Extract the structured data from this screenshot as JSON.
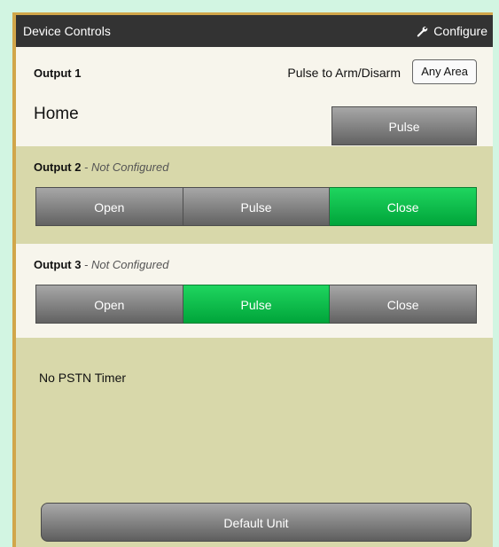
{
  "header": {
    "title": "Device Controls",
    "configure_label": "Configure"
  },
  "output1": {
    "name": "Output 1",
    "status": "Home",
    "pulse_label": "Pulse to Arm/Disarm",
    "area_button": "Any Area",
    "pulse_button": "Pulse"
  },
  "output2": {
    "name": "Output 2",
    "note": " - Not Configured",
    "buttons": [
      "Open",
      "Pulse",
      "Close"
    ],
    "active": "Close"
  },
  "output3": {
    "name": "Output 3",
    "note": " - Not Configured",
    "buttons": [
      "Open",
      "Pulse",
      "Close"
    ],
    "active": "Pulse"
  },
  "pstn": {
    "label": "No PSTN Timer"
  },
  "footer": {
    "default_button": "Default Unit"
  },
  "colors": {
    "titlebar": "#333333",
    "accent_green": "#00b140",
    "panel_olive": "#d8d8aa",
    "panel_light": "#f7f5ec",
    "frame_gold": "#d1a64a"
  },
  "icons": {
    "configure": "wrench-icon"
  }
}
